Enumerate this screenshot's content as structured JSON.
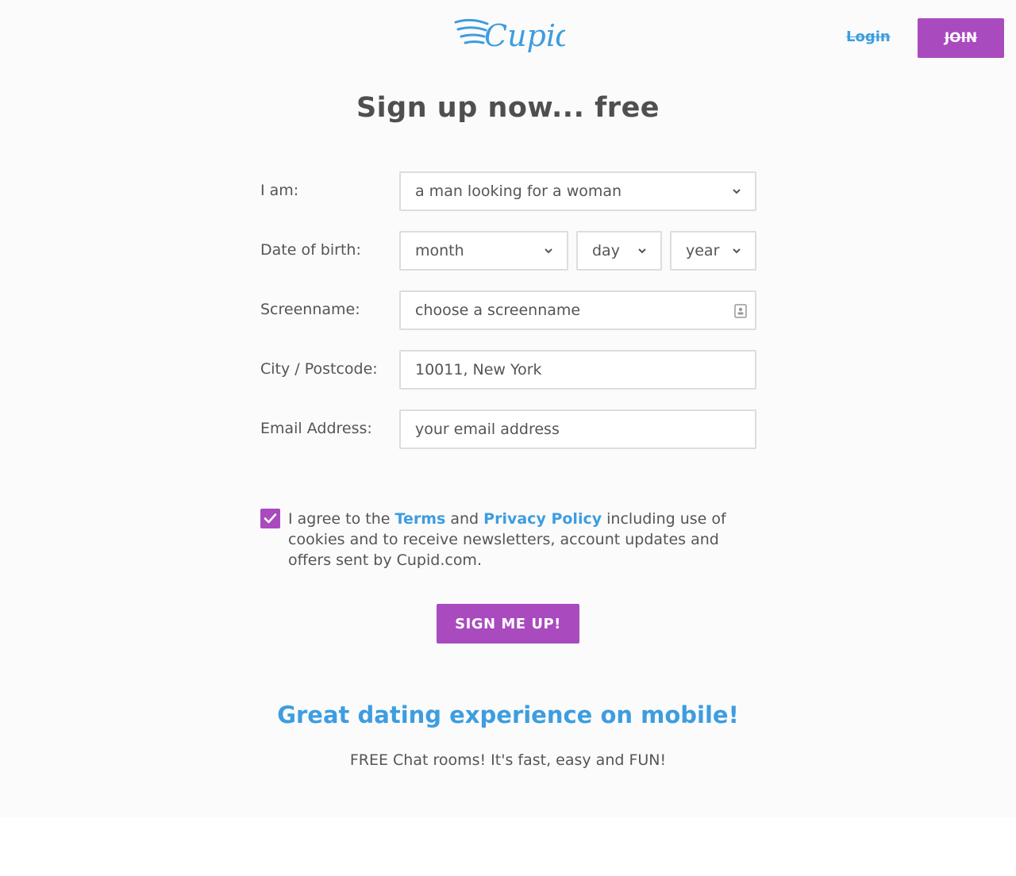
{
  "header": {
    "logo_text": "Cupid",
    "login_label": "Login",
    "join_label": "JOIN"
  },
  "page_title": "Sign up now... free",
  "form": {
    "iam": {
      "label": "I am:",
      "value": "a man looking for a woman"
    },
    "dob": {
      "label": "Date of birth:",
      "month": "month",
      "day": "day",
      "year": "year"
    },
    "screenname": {
      "label": "Screenname:",
      "placeholder": "choose a screenname"
    },
    "city": {
      "label": "City / Postcode:",
      "value": "10011, New York"
    },
    "email": {
      "label": "Email Address:",
      "placeholder": "your email address"
    }
  },
  "consent": {
    "checked": true,
    "text_1": "I agree to the",
    "terms_link": "Terms",
    "text_2": "and",
    "privacy_link": "Privacy Policy",
    "text_3": "including use of cookies and to receive newsletters, account updates and offers sent by Cupid.com."
  },
  "signup_label": "SIGN ME UP!",
  "promo": {
    "title": "Great dating experience on mobile!",
    "subtitle": "FREE Chat rooms! It's fast, easy and FUN!"
  },
  "colors": {
    "brand_blue": "#3d9de0",
    "brand_purple": "#a94bbf",
    "text": "#555555",
    "border": "#dddddd"
  },
  "icons": [
    "cupid-wings-logo",
    "chevron-down-icon",
    "contact-card-icon",
    "checkmark-icon"
  ]
}
